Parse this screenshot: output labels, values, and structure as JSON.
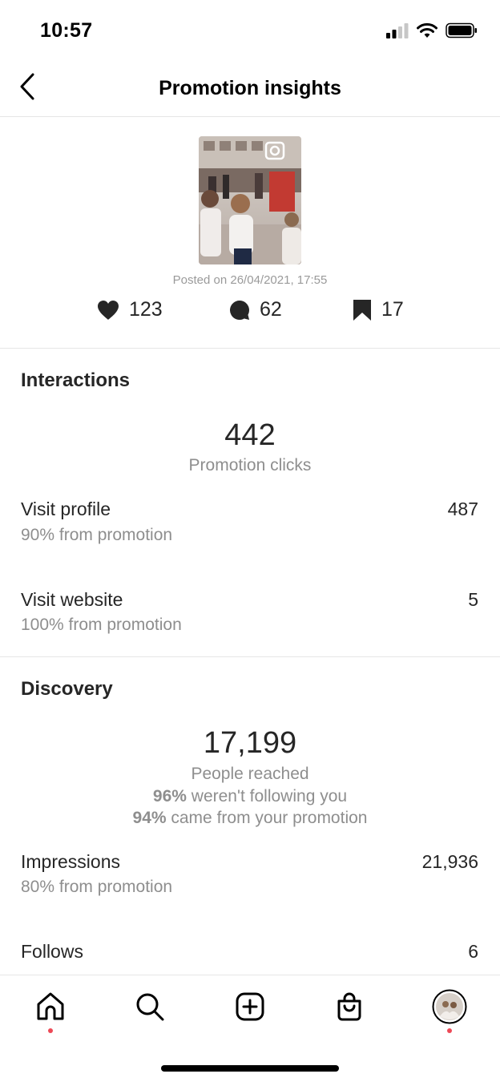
{
  "status_bar": {
    "time": "10:57"
  },
  "header": {
    "title": "Promotion insights"
  },
  "post": {
    "posted_on": "Posted on 26/04/2021, 17:55",
    "likes": "123",
    "comments": "62",
    "saves": "17"
  },
  "interactions": {
    "title": "Interactions",
    "clicks_value": "442",
    "clicks_label": "Promotion clicks",
    "rows": [
      {
        "label": "Visit profile",
        "sub": "90% from promotion",
        "value": "487"
      },
      {
        "label": "Visit website",
        "sub": "100% from promotion",
        "value": "5"
      }
    ]
  },
  "discovery": {
    "title": "Discovery",
    "reached_value": "17,199",
    "reached_label": "People reached",
    "not_following_pct": "96%",
    "not_following_text": " weren't following you",
    "from_promo_pct": "94%",
    "from_promo_text": " came from your promotion",
    "rows": [
      {
        "label": "Impressions",
        "sub": "80% from promotion",
        "value": "21,936"
      },
      {
        "label": "Follows",
        "value": "6"
      }
    ]
  },
  "tab_bar": {
    "icons": [
      "home-icon",
      "search-icon",
      "create-icon",
      "shop-icon",
      "profile-avatar"
    ],
    "dot_color": "#ed4956"
  }
}
